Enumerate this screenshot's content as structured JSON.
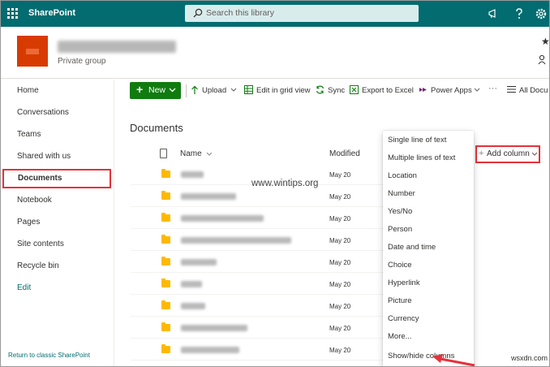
{
  "suitebar": {
    "app_name": "SharePoint",
    "search_placeholder": "Search this library"
  },
  "site": {
    "name": "Creative Department",
    "type": "Private group"
  },
  "leftnav": {
    "items": [
      {
        "label": "Home"
      },
      {
        "label": "Conversations"
      },
      {
        "label": "Teams"
      },
      {
        "label": "Shared with us"
      },
      {
        "label": "Documents"
      },
      {
        "label": "Notebook"
      },
      {
        "label": "Pages"
      },
      {
        "label": "Site contents"
      },
      {
        "label": "Recycle bin"
      }
    ],
    "edit_label": "Edit",
    "return_label": "Return to classic SharePoint"
  },
  "commandbar": {
    "new_label": "New",
    "upload_label": "Upload",
    "grid_label": "Edit in grid view",
    "sync_label": "Sync",
    "excel_label": "Export to Excel",
    "powerapps_label": "Power Apps",
    "more_label": "···",
    "alldocs_label": "All Docu"
  },
  "library": {
    "title": "Documents",
    "columns": {
      "name": "Name",
      "modified": "Modified",
      "add_column": "Add column"
    },
    "rows": [
      {
        "name": "Assets",
        "modified": "May 20"
      },
      {
        "name": "Creative Review",
        "modified": "May 20"
      },
      {
        "name": "Digital Assets Library",
        "modified": "May 20"
      },
      {
        "name": "Digital Assets Library Archive",
        "modified": "May 20"
      },
      {
        "name": "Planning",
        "modified": "May 20"
      },
      {
        "name": "Video",
        "modified": "May 20"
      },
      {
        "name": "Brand",
        "modified": "May 20"
      },
      {
        "name": "Brand Guidelines",
        "modified": "May 20"
      },
      {
        "name": "Shared Folder",
        "modified": "May 20"
      }
    ]
  },
  "add_column_menu": {
    "items": [
      "Single line of text",
      "Multiple lines of text",
      "Location",
      "Number",
      "Yes/No",
      "Person",
      "Date and time",
      "Choice",
      "Hyperlink",
      "Picture",
      "Currency",
      "More...",
      "Show/hide columns"
    ]
  },
  "watermark": "www.wintips.org",
  "site_tag": "wsxdn.com",
  "colors": {
    "suitebar": "#036c70",
    "new_button": "#107c10",
    "highlight": "#e5323b",
    "logo": "#d83b01",
    "folder": "#ffb900"
  }
}
